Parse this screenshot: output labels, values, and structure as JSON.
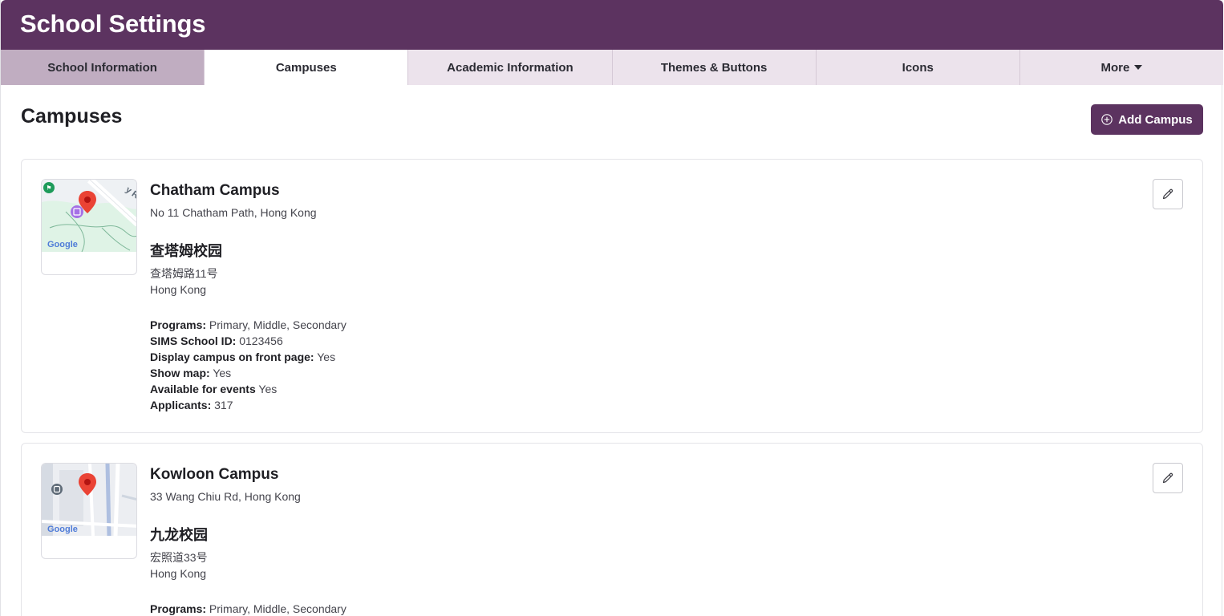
{
  "header": {
    "title": "School Settings"
  },
  "tabs": [
    {
      "label": "School Information"
    },
    {
      "label": "Campuses"
    },
    {
      "label": "Academic Information"
    },
    {
      "label": "Themes & Buttons"
    },
    {
      "label": "Icons"
    },
    {
      "label": "More"
    }
  ],
  "active_tab": "Campuses",
  "main": {
    "title": "Campuses",
    "add_button": "Add Campus"
  },
  "campuses": [
    {
      "name": "Chatham Campus",
      "address": "No 11 Chatham Path, Hong Kong",
      "chinese_name": "查塔姆校园",
      "chinese_address_line1": "查塔姆路11号",
      "chinese_address_line2": "Hong Kong",
      "map_road_label": "y Rd",
      "map_logo": "Google",
      "details": [
        {
          "label": "Programs:",
          "value": "Primary, Middle, Secondary"
        },
        {
          "label": "SIMS School ID:",
          "value": "0123456"
        },
        {
          "label": "Display campus on front page:",
          "value": "Yes"
        },
        {
          "label": "Show map:",
          "value": "Yes"
        },
        {
          "label": "Available for events",
          "value": "Yes"
        },
        {
          "label": "Applicants:",
          "value": "317"
        }
      ]
    },
    {
      "name": "Kowloon Campus",
      "address": "33 Wang Chiu Rd, Hong Kong",
      "chinese_name": "九龙校园",
      "chinese_address_line1": "宏照道33号",
      "chinese_address_line2": "Hong Kong",
      "map_logo": "Google",
      "details": [
        {
          "label": "Programs:",
          "value": "Primary, Middle, Secondary"
        }
      ]
    }
  ],
  "colors": {
    "brand": "#5c3360",
    "tab_bar": "#ece3ec",
    "tab_first": "#c0adc1",
    "map_pin": "#ea4335"
  },
  "icons": {
    "add": "plus-circle-icon",
    "edit": "pencil-icon",
    "more": "caret-down-icon",
    "map_pin": "map-pin-icon"
  }
}
